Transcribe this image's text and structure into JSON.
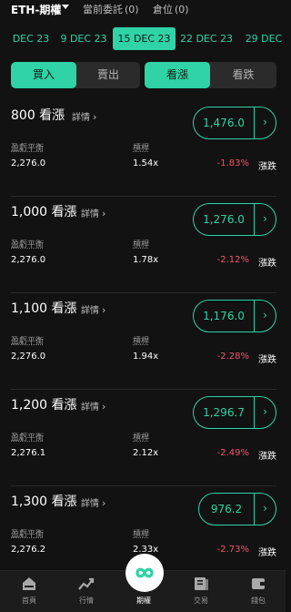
{
  "header": {
    "title": "ETH-期權",
    "tabs": [
      {
        "label": "當前委託",
        "count": "(0)"
      },
      {
        "label": "倉位",
        "count": "(0)"
      }
    ]
  },
  "dates": [
    {
      "label": "DEC 23",
      "active": false
    },
    {
      "label": "9 DEC 23",
      "active": false
    },
    {
      "label": "15 DEC 23",
      "active": true
    },
    {
      "label": "22 DEC 23",
      "active": false
    },
    {
      "label": "29 DEC",
      "active": false
    }
  ],
  "side_segment": {
    "buy": "買入",
    "sell": "賣出",
    "selected": "buy"
  },
  "type_segment": {
    "call": "看漲",
    "put": "看跌",
    "selected": "call"
  },
  "labels": {
    "details": "詳情",
    "breakeven": "盈虧平衡",
    "leverage": "槓桿",
    "change": "漲跌"
  },
  "options": [
    {
      "strike": "800 看漲",
      "price": "1,476.0",
      "breakeven": "2,276.0",
      "leverage": "1.54x",
      "change": "-1.83%"
    },
    {
      "strike": "1,000 看漲",
      "price": "1,276.0",
      "breakeven": "2,276.0",
      "leverage": "1.78x",
      "change": "-2.12%"
    },
    {
      "strike": "1,100 看漲",
      "price": "1,176.0",
      "breakeven": "2,276.0",
      "leverage": "1.94x",
      "change": "-2.28%"
    },
    {
      "strike": "1,200 看漲",
      "price": "1,296.7",
      "breakeven": "2,276.1",
      "leverage": "2.12x",
      "change": "-2.49%"
    },
    {
      "strike": "1,300 看漲",
      "price": "976.2",
      "breakeven": "2,276.2",
      "leverage": "2.33x",
      "change": "-2.73%"
    }
  ],
  "bottom_nav": [
    {
      "label": "首頁",
      "icon": "home-icon"
    },
    {
      "label": "行情",
      "icon": "chart-icon"
    },
    {
      "label": "期權",
      "icon": "options-icon",
      "active": true
    },
    {
      "label": "交易",
      "icon": "trade-icon"
    },
    {
      "label": "錢包",
      "icon": "wallet-icon"
    }
  ],
  "colors": {
    "accent": "#2fd3a6",
    "negative": "#f0556a",
    "background": "#121212"
  }
}
